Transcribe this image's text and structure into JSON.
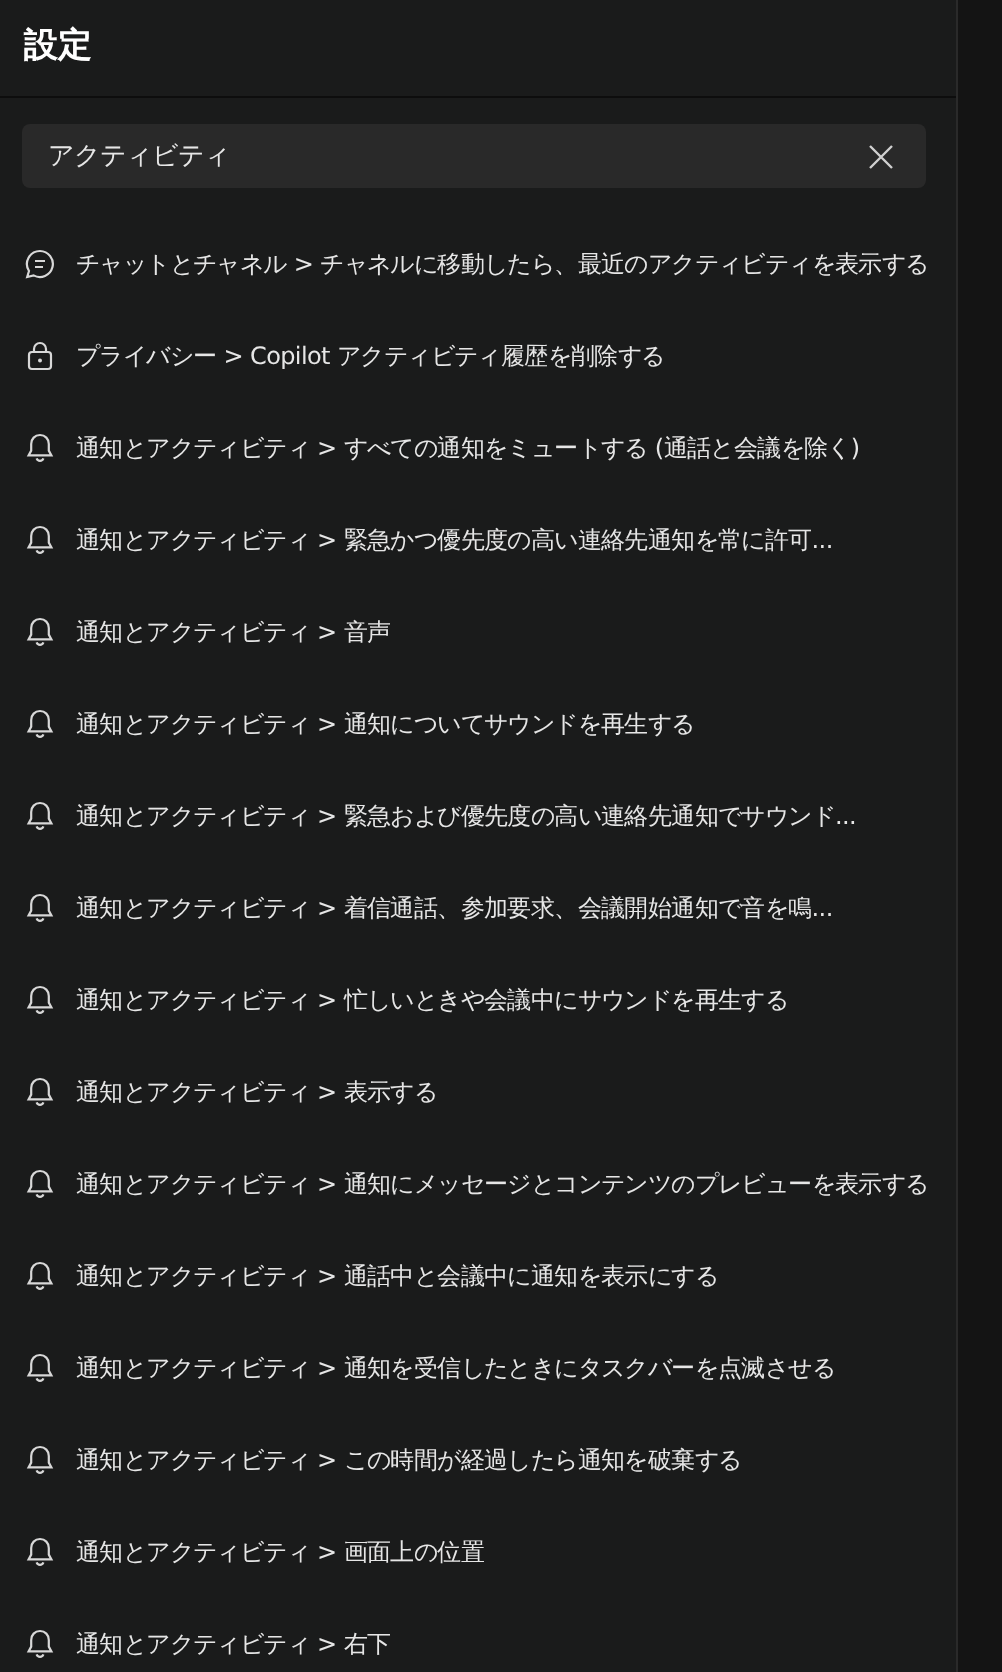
{
  "header": {
    "title": "設定"
  },
  "search": {
    "value": "アクティビティ"
  },
  "results": [
    {
      "kind": "chat",
      "text": "チャットとチャネル > チャネルに移動したら、最近のアクティビティを表示する"
    },
    {
      "kind": "lock",
      "text": "プライバシー > Copilot アクティビティ履歴を削除する"
    },
    {
      "kind": "bell",
      "text": "通知とアクティビティ > すべての通知をミュートする (通話と会議を除く)"
    },
    {
      "kind": "bell",
      "text": "通知とアクティビティ > 緊急かつ優先度の高い連絡先通知を常に許可..."
    },
    {
      "kind": "bell",
      "text": "通知とアクティビティ > 音声"
    },
    {
      "kind": "bell",
      "text": "通知とアクティビティ > 通知についてサウンドを再生する"
    },
    {
      "kind": "bell",
      "text": "通知とアクティビティ > 緊急および優先度の高い連絡先通知でサウンド..."
    },
    {
      "kind": "bell",
      "text": "通知とアクティビティ > 着信通話、参加要求、会議開始通知で音を鳴..."
    },
    {
      "kind": "bell",
      "text": "通知とアクティビティ > 忙しいときや会議中にサウンドを再生する"
    },
    {
      "kind": "bell",
      "text": "通知とアクティビティ > 表示する"
    },
    {
      "kind": "bell",
      "text": "通知とアクティビティ > 通知にメッセージとコンテンツのプレビューを表示する"
    },
    {
      "kind": "bell",
      "text": "通知とアクティビティ > 通話中と会議中に通知を表示にする"
    },
    {
      "kind": "bell",
      "text": "通知とアクティビティ > 通知を受信したときにタスクバーを点滅させる"
    },
    {
      "kind": "bell",
      "text": "通知とアクティビティ > この時間が経過したら通知を破棄する"
    },
    {
      "kind": "bell",
      "text": "通知とアクティビティ > 画面上の位置"
    },
    {
      "kind": "bell",
      "text": "通知とアクティビティ > 右下"
    }
  ]
}
